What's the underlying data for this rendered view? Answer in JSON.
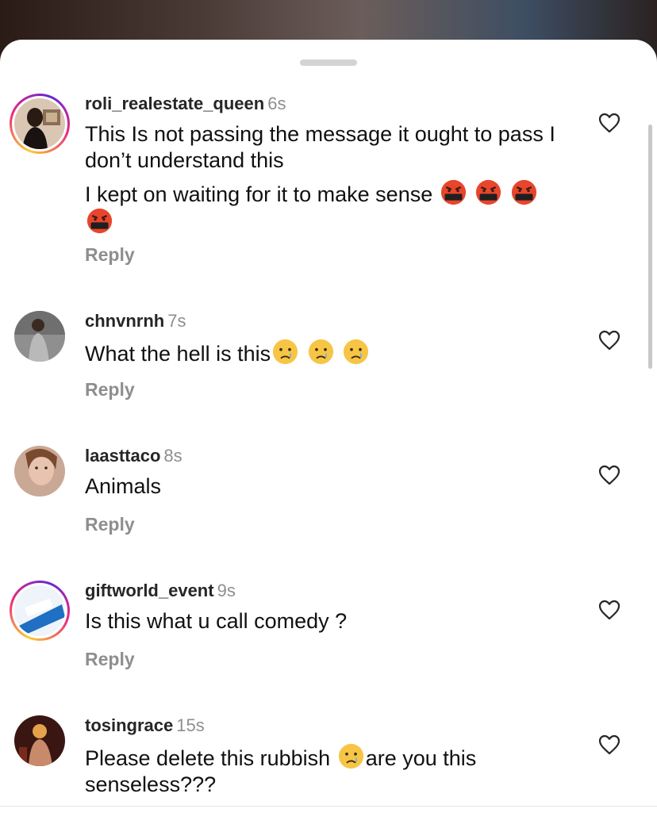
{
  "comments": [
    {
      "username": "roli_realestate_queen",
      "time": "6s",
      "lines": [
        "This Is not passing the message it ought to pass I don’t understand this",
        "I kept on waiting for it to make sense"
      ],
      "emoji": "face-with-symbols-on-mouth",
      "emoji_count": 4,
      "reply_label": "Reply",
      "story_ring": true
    },
    {
      "username": "chnvnrnh",
      "time": "7s",
      "text": "What the hell is this",
      "emoji": "crying-face",
      "emoji_count": 3,
      "reply_label": "Reply",
      "story_ring": false
    },
    {
      "username": "laasttaco",
      "time": "8s",
      "text": "Animals",
      "reply_label": "Reply",
      "story_ring": false
    },
    {
      "username": "giftworld_event",
      "time": "9s",
      "text": "Is this what u call comedy ?",
      "reply_label": "Reply",
      "story_ring": true
    },
    {
      "username": "tosingrace",
      "time": "15s",
      "text_before": "Please delete this rubbish",
      "text_after": "are you this senseless???",
      "emoji": "crying-face",
      "story_ring": false
    }
  ],
  "icons": {
    "like": "heart-outline-icon",
    "grabber": "sheet-grabber"
  },
  "colors": {
    "username": "#262626",
    "secondary": "#8e8e8e",
    "story_ring": [
      "#f9ce34",
      "#ee2a7b",
      "#6228d7"
    ]
  }
}
